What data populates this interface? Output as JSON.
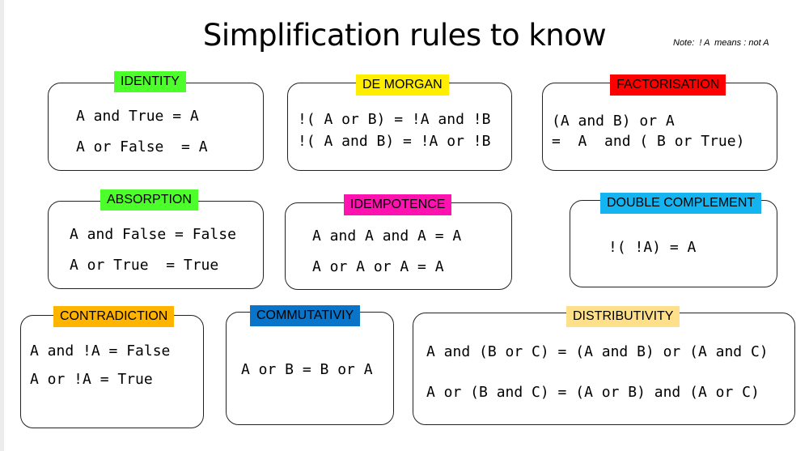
{
  "title": "Simplification rules to know",
  "note": "Note:  ! A  means : not A",
  "rules": {
    "identity": {
      "label": "IDENTITY",
      "color": "#4cff2a",
      "lines": [
        "A and True = A",
        "A or False  = A"
      ]
    },
    "demorgan": {
      "label": "DE MORGAN",
      "color": "#ffee00",
      "lines": [
        "!( A or B) = !A and !B",
        "!( A and B) = !A or !B"
      ]
    },
    "factorisation": {
      "label": "FACTORISATION",
      "color": "#ff0000",
      "lines": [
        "(A and B) or A",
        "=  A  and ( B or True)"
      ]
    },
    "absorption": {
      "label": "ABSORPTION",
      "color": "#4cff2a",
      "lines": [
        "A and False = False",
        "A or True  = True"
      ]
    },
    "idempotence": {
      "label": "IDEMPOTENCE",
      "color": "#ff12b0",
      "lines": [
        "A and A and A = A",
        "A or A or A = A"
      ]
    },
    "double_complement": {
      "label": "DOUBLE COMPLEMENT",
      "color": "#13b4f0",
      "lines": [
        "!( !A) = A"
      ]
    },
    "contradiction": {
      "label": "CONTRADICTION",
      "color": "#ffb400",
      "lines": [
        "A and !A = False",
        "A or !A = True"
      ]
    },
    "commutativity": {
      "label": "COMMUTATIVIY",
      "color": "#0a74c8",
      "lines": [
        "A or B = B or A"
      ]
    },
    "distributivity": {
      "label": "DISTRIBUTIVITY",
      "color": "#ffe08a",
      "lines": [
        "A and (B or C) = (A and B) or (A and C)",
        "A or (B and C) = (A or B) and (A or C)"
      ]
    }
  }
}
